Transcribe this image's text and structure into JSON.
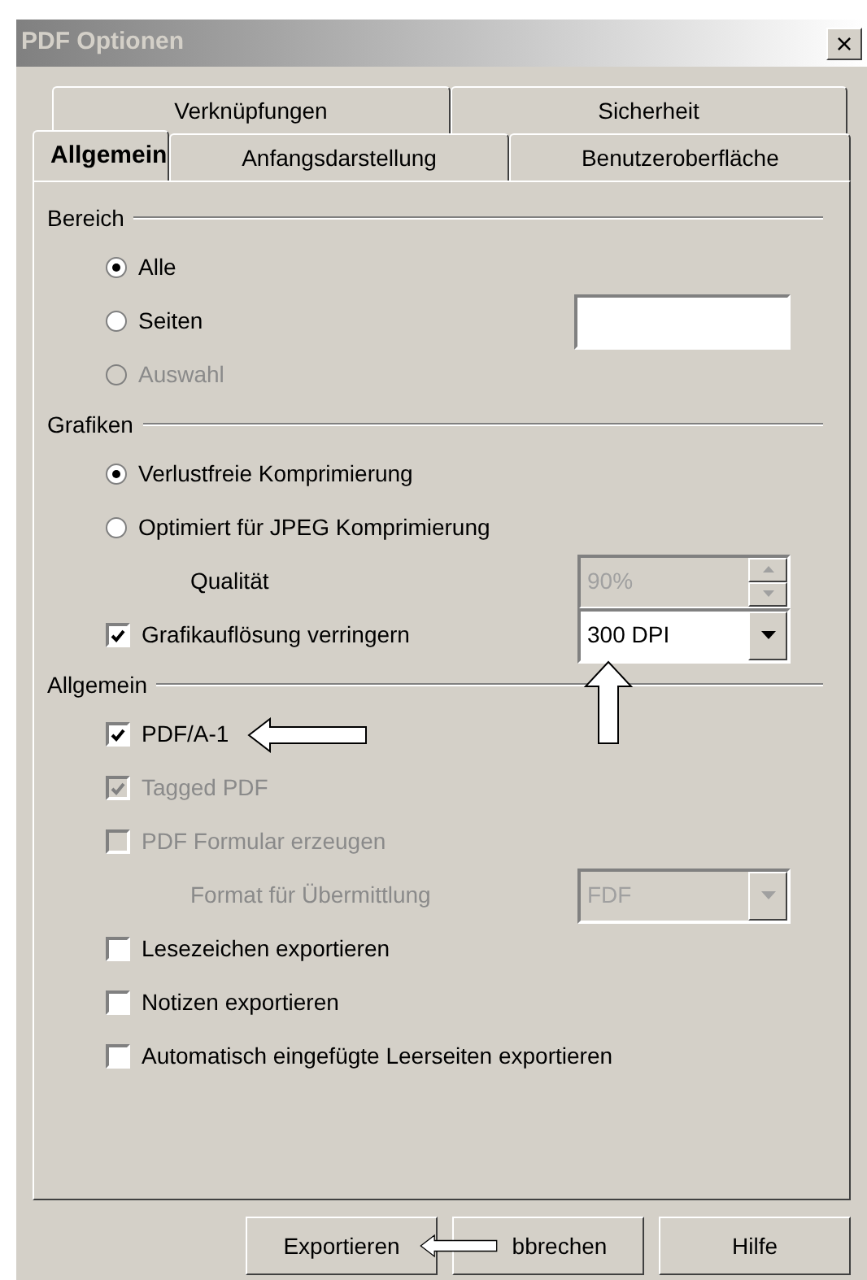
{
  "window": {
    "title": "PDF Optionen",
    "close": "×"
  },
  "tab_rows": [
    [
      {
        "label": "Verknüpfungen",
        "selected": false
      },
      {
        "label": "Sicherheit",
        "selected": false
      }
    ],
    [
      {
        "label": "Allgemein",
        "selected": true
      },
      {
        "label": "Anfangsdarstellung",
        "selected": false
      },
      {
        "label": "Benutzeroberfläche",
        "selected": false
      }
    ]
  ],
  "sections": [
    {
      "title": "Bereich",
      "rows": [
        {
          "kind": "radio",
          "label": "Alle",
          "selected": true,
          "disabled": false
        },
        {
          "kind": "radio",
          "label": "Seiten",
          "selected": false,
          "disabled": false,
          "field": {
            "kind": "text",
            "disabled": false
          }
        },
        {
          "kind": "radio",
          "label": "Auswahl",
          "selected": false,
          "disabled": true
        }
      ]
    },
    {
      "title": "Grafiken",
      "rows": [
        {
          "kind": "radio",
          "label": "Verlustfreie Komprimierung",
          "selected": true,
          "disabled": false
        },
        {
          "kind": "radio",
          "label": "Optimiert für JPEG Komprimierung",
          "selected": false,
          "disabled": false
        },
        {
          "kind": "label",
          "label": "Qualität",
          "disabled": false,
          "field": {
            "kind": "spin",
            "value": "90%",
            "disabled": true
          }
        },
        {
          "kind": "checkbox",
          "label": "Grafikauflösung verringern",
          "checked": true,
          "disabled": false,
          "field": {
            "kind": "select",
            "value": "300 DPI",
            "disabled": false
          }
        }
      ]
    },
    {
      "title": "Allgemein",
      "rows": [
        {
          "kind": "checkbox",
          "label": "PDF/A-1",
          "checked": true,
          "disabled": false
        },
        {
          "kind": "checkbox",
          "label": "Tagged PDF",
          "checked": true,
          "disabled": true
        },
        {
          "kind": "checkbox",
          "label": "PDF Formular erzeugen",
          "checked": false,
          "disabled": true
        },
        {
          "kind": "label",
          "label": "Format für Übermittlung",
          "disabled": true,
          "field": {
            "kind": "select",
            "value": "FDF",
            "disabled": true
          }
        },
        {
          "kind": "checkbox",
          "label": "Lesezeichen exportieren",
          "checked": false,
          "disabled": false
        },
        {
          "kind": "checkbox",
          "label": "Notizen exportieren",
          "checked": false,
          "disabled": false
        },
        {
          "kind": "checkbox",
          "label": "Automatisch eingefügte Leerseiten exportieren",
          "checked": false,
          "disabled": false
        }
      ]
    }
  ],
  "buttons": [
    "Exportieren",
    "bbrechen",
    "Hilfe"
  ]
}
